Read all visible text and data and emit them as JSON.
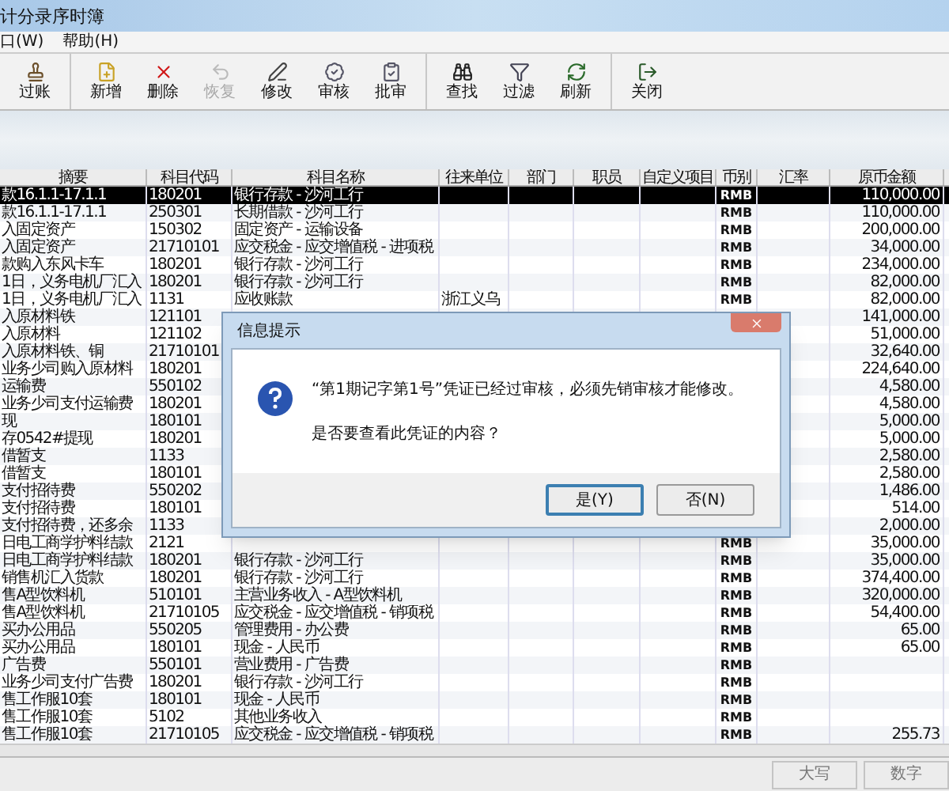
{
  "window": {
    "title": "计分录序时簿"
  },
  "menu": [
    {
      "label": "口(W)"
    },
    {
      "label": "帮助(H)"
    }
  ],
  "toolbar": [
    [
      {
        "label": "过账",
        "disabled": false
      }
    ],
    [
      {
        "label": "新增",
        "disabled": false
      },
      {
        "label": "删除",
        "disabled": false
      },
      {
        "label": "恢复",
        "disabled": true
      },
      {
        "label": "修改",
        "disabled": false
      },
      {
        "label": "审核",
        "disabled": false
      },
      {
        "label": "批审",
        "disabled": false
      }
    ],
    [
      {
        "label": "查找",
        "disabled": false
      },
      {
        "label": "过滤",
        "disabled": false
      },
      {
        "label": "刷新",
        "disabled": false
      }
    ],
    [
      {
        "label": "关闭",
        "disabled": false
      }
    ]
  ],
  "table": {
    "columns": [
      "摘要",
      "科目代码",
      "科目名称",
      "往来单位",
      "部门",
      "职员",
      "自定义项目",
      "币别",
      "汇率",
      "原币金额"
    ],
    "rows": [
      {
        "summary": "款16.1.1-17.1.1",
        "code": "180201",
        "account": "银行存款 - 沙河工行",
        "currency": "RMB",
        "amount": "110,000.00",
        "selected": true
      },
      {
        "summary": "款16.1.1-17.1.1",
        "code": "250301",
        "account": "长期借款 - 沙河工行",
        "currency": "RMB",
        "amount": "110,000.00",
        "selected": false
      },
      {
        "summary": "入固定资产",
        "code": "150302",
        "account": "固定资产 - 运输设备",
        "currency": "RMB",
        "amount": "200,000.00",
        "selected": false
      },
      {
        "summary": "入固定资产",
        "code": "21710101",
        "account": "应交税金 - 应交增值税 - 进项税",
        "currency": "RMB",
        "amount": "34,000.00",
        "selected": false
      },
      {
        "summary": "款购入东风卡车",
        "code": "180201",
        "account": "银行存款 - 沙河工行",
        "currency": "RMB",
        "amount": "234,000.00",
        "selected": false
      },
      {
        "summary": "1日，义务电机厂汇入",
        "code": "180201",
        "account": "银行存款 - 沙河工行",
        "currency": "RMB",
        "amount": "82,000.00",
        "selected": false
      },
      {
        "summary": "1日，义务电机厂汇入",
        "code": "1131",
        "account": "应收账款",
        "partner": "浙江义乌",
        "currency": "RMB",
        "amount": "82,000.00",
        "selected": false
      },
      {
        "summary": "入原材料铁",
        "code": "121101",
        "amount": "141,000.00",
        "selected": false
      },
      {
        "summary": "入原材料",
        "code": "121102",
        "amount": "51,000.00",
        "selected": false
      },
      {
        "summary": "入原材料铁、铜",
        "code": "21710101",
        "amount": "32,640.00",
        "selected": false
      },
      {
        "summary": "业务少司购入原材料",
        "code": "180201",
        "amount": "224,640.00",
        "selected": false
      },
      {
        "summary": "运输费",
        "code": "550102",
        "amount": "4,580.00",
        "selected": false
      },
      {
        "summary": "业务少司支付运输费",
        "code": "180201",
        "amount": "4,580.00",
        "selected": false
      },
      {
        "summary": "现",
        "code": "180101",
        "amount": "5,000.00",
        "selected": false
      },
      {
        "summary": "存0542#提现",
        "code": "180201",
        "amount": "5,000.00",
        "selected": false
      },
      {
        "summary": "借暂支",
        "code": "1133",
        "amount": "2,580.00",
        "selected": false
      },
      {
        "summary": "借暂支",
        "code": "180101",
        "amount": "2,580.00",
        "selected": false
      },
      {
        "summary": "支付招待费",
        "code": "550202",
        "amount": "1,486.00",
        "selected": false
      },
      {
        "summary": "支付招待费",
        "code": "180101",
        "amount": "514.00",
        "selected": false
      },
      {
        "summary": "支付招待费，还多余",
        "code": "1133",
        "amount": "2,000.00",
        "selected": false
      },
      {
        "summary": "日电工商学护料结款",
        "code": "2121",
        "currency": "RMB",
        "amount": "35,000.00",
        "selected": false
      },
      {
        "summary": "日电工商学护料结款",
        "code": "180201",
        "account": "银行存款 - 沙河工行",
        "currency": "RMB",
        "amount": "35,000.00",
        "selected": false
      },
      {
        "summary": "销售机汇入货款",
        "code": "180201",
        "account": "银行存款 - 沙河工行",
        "currency": "RMB",
        "amount": "374,400.00",
        "selected": false
      },
      {
        "summary": "售A型饮料机",
        "code": "510101",
        "account": "主营业务收入 - A型饮料机",
        "currency": "RMB",
        "amount": "320,000.00",
        "selected": false
      },
      {
        "summary": "售A型饮料机",
        "code": "21710105",
        "account": "应交税金 - 应交增值税 - 销项税",
        "currency": "RMB",
        "amount": "54,400.00",
        "selected": false
      },
      {
        "summary": "买办公用品",
        "code": "550205",
        "account": "管理费用 - 办公费",
        "currency": "RMB",
        "amount": "65.00",
        "selected": false
      },
      {
        "summary": "买办公用品",
        "code": "180101",
        "account": "现金 - 人民币",
        "currency": "RMB",
        "amount": "65.00",
        "selected": false
      },
      {
        "summary": "广告费",
        "code": "550101",
        "account": "营业费用 - 广告费",
        "currency": "RMB",
        "selected": false
      },
      {
        "summary": "业务少司支付广告费",
        "code": "180201",
        "account": "银行存款 - 沙河工行",
        "currency": "RMB",
        "selected": false
      },
      {
        "summary": "售工作服10套",
        "code": "180101",
        "account": "现金 - 人民币",
        "currency": "RMB",
        "selected": false
      },
      {
        "summary": "售工作服10套",
        "code": "5102",
        "account": "其他业务收入",
        "currency": "RMB",
        "selected": false
      },
      {
        "summary": "售工作服10套",
        "code": "21710105",
        "account": "应交税金 - 应交增值税 - 销项税",
        "currency": "RMB",
        "amount": "255.73",
        "selected": false
      }
    ]
  },
  "dialog": {
    "title": "信息提示",
    "message": "“第1期记字第1号”凭证已经过审核，必须先销审核才能修改。",
    "question": "是否要查看此凭证的内容？",
    "buttons": [
      {
        "label": "是(Y)",
        "selected": true
      },
      {
        "label": "否(N)",
        "selected": false
      }
    ]
  },
  "status_bar": [
    "大写",
    "数字"
  ]
}
